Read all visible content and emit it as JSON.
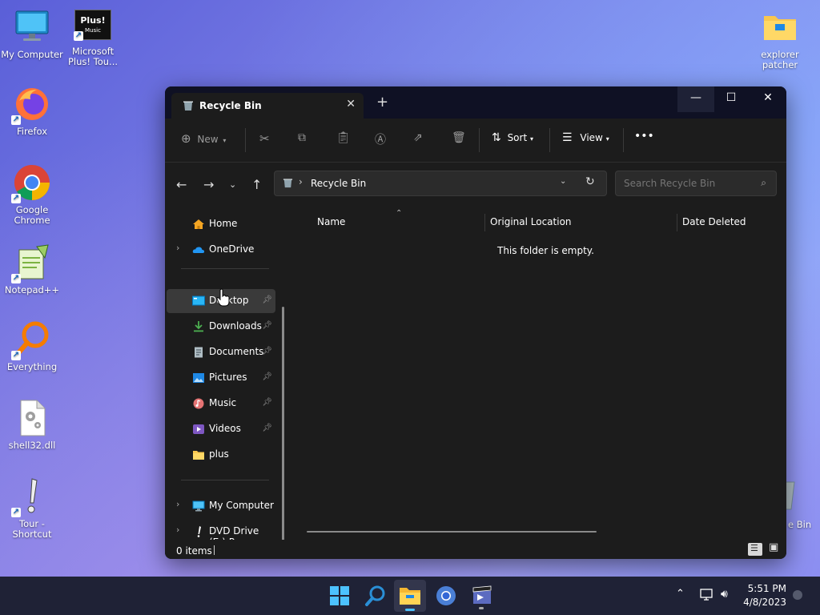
{
  "desktop": {
    "icons": [
      {
        "label": "My Computer"
      },
      {
        "label": "Microsoft Plus! Tou..."
      },
      {
        "label": "Firefox"
      },
      {
        "label": "Google Chrome"
      },
      {
        "label": "Notepad++"
      },
      {
        "label": "Everything"
      },
      {
        "label": "shell32.dll"
      },
      {
        "label": "Tour - Shortcut"
      },
      {
        "label": "explorer patcher"
      }
    ],
    "plus_logo_text": "Plus!",
    "plus_logo_sub": "Music",
    "recycle_partial_label": "e Bin"
  },
  "window": {
    "tab_title": "Recycle Bin",
    "new_tab_symbol": "+",
    "toolbar": {
      "new_label": "New",
      "sort_label": "Sort",
      "view_label": "View",
      "more_label": "•••"
    },
    "address": {
      "location": "Recycle Bin"
    },
    "search": {
      "placeholder": "Search Recycle Bin"
    },
    "sidebar": {
      "home": "Home",
      "onedrive": "OneDrive",
      "desktop": "Desktop",
      "downloads": "Downloads",
      "documents": "Documents",
      "pictures": "Pictures",
      "music": "Music",
      "videos": "Videos",
      "plus": "plus",
      "my_computer": "My Computer",
      "dvd": "DVD Drive (E:) P"
    },
    "columns": {
      "name": "Name",
      "original_location": "Original Location",
      "date_deleted": "Date Deleted"
    },
    "empty_message": "This folder is empty.",
    "status": {
      "items": "0 items"
    }
  },
  "taskbar": {
    "time": "5:51 PM",
    "date": "4/8/2023"
  },
  "colors": {
    "accent": "#4cc2ff",
    "window_bg": "#1c1c1c",
    "titlebar_bg": "#0f1124",
    "taskbar_bg": "#1f2236"
  }
}
